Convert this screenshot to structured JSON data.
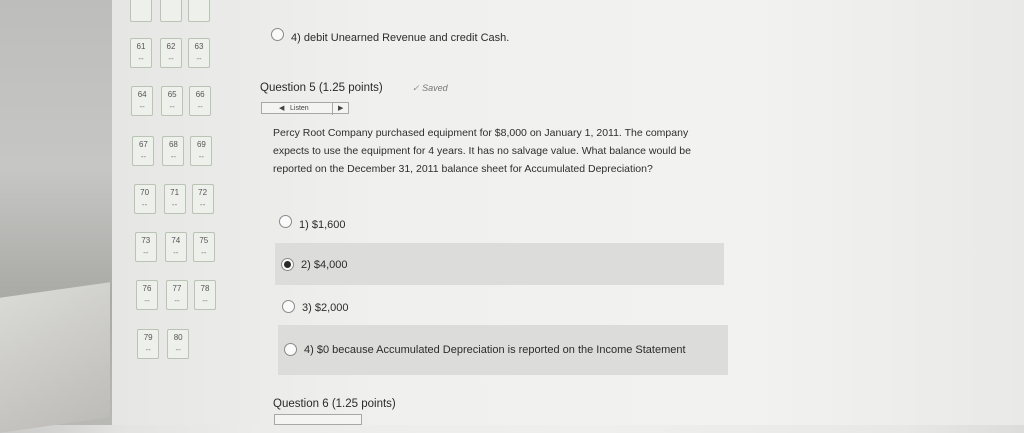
{
  "question_nav": {
    "cells": [
      {
        "num": "61",
        "mark": "--"
      },
      {
        "num": "62",
        "mark": "--"
      },
      {
        "num": "63",
        "mark": "--"
      },
      {
        "num": "64",
        "mark": "--"
      },
      {
        "num": "65",
        "mark": "--"
      },
      {
        "num": "66",
        "mark": "--"
      },
      {
        "num": "67",
        "mark": "--"
      },
      {
        "num": "68",
        "mark": "--"
      },
      {
        "num": "69",
        "mark": "--"
      },
      {
        "num": "70",
        "mark": "--"
      },
      {
        "num": "71",
        "mark": "--"
      },
      {
        "num": "72",
        "mark": "--"
      },
      {
        "num": "73",
        "mark": "--"
      },
      {
        "num": "74",
        "mark": "--"
      },
      {
        "num": "75",
        "mark": "--"
      },
      {
        "num": "76",
        "mark": "--"
      },
      {
        "num": "77",
        "mark": "--"
      },
      {
        "num": "78",
        "mark": "--"
      },
      {
        "num": "79",
        "mark": "--"
      },
      {
        "num": "80",
        "mark": "--"
      }
    ]
  },
  "prev_question": {
    "option4": "4)  debit Unearned Revenue and credit Cash."
  },
  "question5": {
    "title": "Question 5 (1.25 points)",
    "saved": "Saved",
    "listen_label": "Listen",
    "body": "Percy Root Company purchased equipment for $8,000 on January 1, 2011. The company expects to use the equipment for 4 years. It has no salvage value. What balance would be reported on the December 31, 2011 balance sheet for Accumulated Depreciation?",
    "options": [
      {
        "label": "1)  $1,600",
        "selected": false
      },
      {
        "label": "2)  $4,000",
        "selected": true
      },
      {
        "label": "3)  $2,000",
        "selected": false
      },
      {
        "label": "4)  $0 because Accumulated Depreciation is reported on the Income Statement",
        "selected": false
      }
    ]
  },
  "question6": {
    "title": "Question 6 (1.25 points)"
  }
}
